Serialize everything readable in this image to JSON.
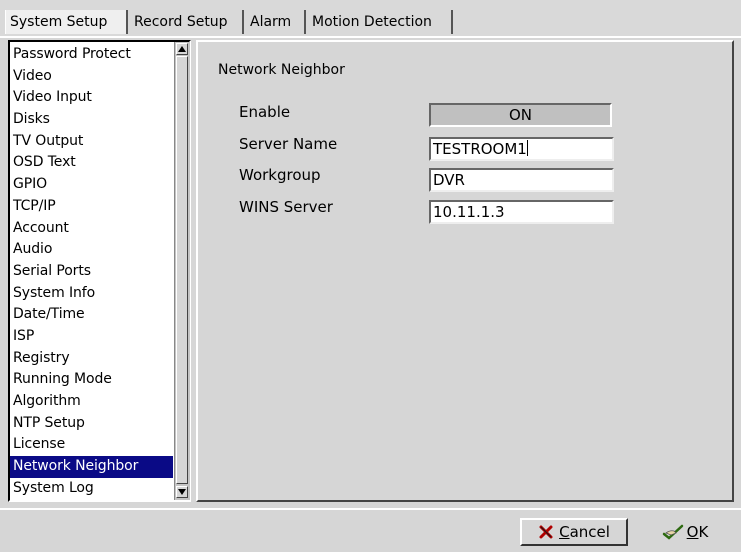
{
  "tabs": [
    {
      "label": "System Setup",
      "active": true
    },
    {
      "label": "Record Setup",
      "active": false
    },
    {
      "label": "Alarm",
      "active": false
    },
    {
      "label": "Motion Detection",
      "active": false
    }
  ],
  "sidebar": {
    "items": [
      "Password Protect",
      "Video",
      "Video Input",
      "Disks",
      "TV Output",
      "OSD Text",
      "GPIO",
      "TCP/IP",
      "Account",
      "Audio",
      "Serial Ports",
      "System Info",
      "Date/Time",
      "ISP",
      "Registry",
      "Running Mode",
      "Algorithm",
      "NTP Setup",
      "License",
      "Network Neighbor",
      "System Log"
    ],
    "selected": "Network Neighbor"
  },
  "panel": {
    "title": "Network Neighbor",
    "enable_label": "Enable",
    "enable_value": "ON",
    "server_name_label": "Server Name",
    "server_name_value": "TESTROOM1",
    "workgroup_label": "Workgroup",
    "workgroup_value": "DVR",
    "wins_label": "WINS Server",
    "wins_value": "10.11.1.3"
  },
  "footer": {
    "cancel_mnemonic": "C",
    "cancel_rest": "ancel",
    "ok_mnemonic": "O",
    "ok_rest": "K"
  },
  "icons": {
    "cancel": "x-mark-icon",
    "ok": "checkmark-hand-icon",
    "scroll_up": "arrow-up-icon",
    "scroll_down": "arrow-down-icon"
  }
}
